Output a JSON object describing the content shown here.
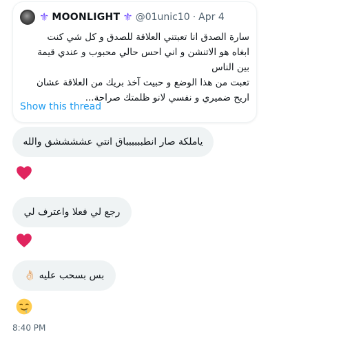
{
  "quote": {
    "display_name": "MOONLIGHT",
    "handle": "@01unic10",
    "separator": "·",
    "date": "Apr 4",
    "fleur_left": "⚜",
    "fleur_right": "⚜",
    "body_lines": [
      "سارة الصدق انا تعبتني العلاقة للصدق و كل شي كنت",
      "ابغاه هو الاتنشن و اني احس حالي محبوب و عندي قيمة",
      "بين الناس",
      "تعبت من هذا الوضع و حبيت آخذ بريك من العلاقة عشان",
      "اريح ضميري و نفسي لانو ظلمتك صراحة..."
    ],
    "show_thread_label": "Show this thread"
  },
  "messages": [
    {
      "text": "ياملكة صار انطبببببباق انتي عششششق والله",
      "reaction": "red-heart-icon"
    },
    {
      "text": "رجع لي فعلا واعترف لي",
      "reaction": "red-heart-icon"
    },
    {
      "text": "بس بسحب عليه 👌🏻",
      "reaction": "drooling-face-icon"
    }
  ],
  "timestamp": "8:40 PM",
  "colors": {
    "accent": "#1d9bf0",
    "bubble_bg": "#eff3f4",
    "heart": "#e0245e",
    "fleur": "#7856ff",
    "muted": "#536471"
  }
}
